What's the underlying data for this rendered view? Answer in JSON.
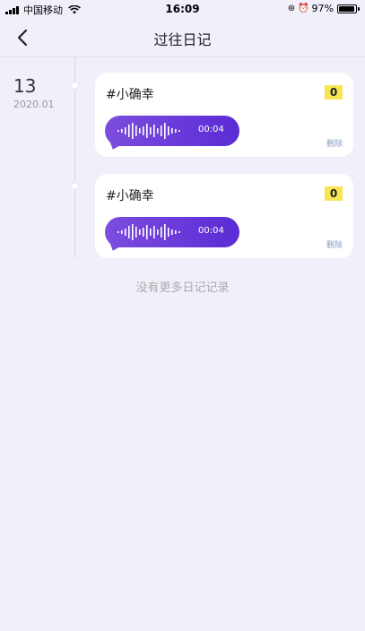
{
  "status_bar": {
    "carrier": "中国移动",
    "time": "16:09",
    "battery_text": "97%",
    "battery_level": 0.97
  },
  "nav": {
    "title": "过往日记"
  },
  "timeline": {
    "day": "13",
    "year_month": "2020.01"
  },
  "entries": [
    {
      "tag": "#小确幸",
      "count": "0",
      "duration": "00:04",
      "delete_label": "删除"
    },
    {
      "tag": "#小确幸",
      "count": "0",
      "duration": "00:04",
      "delete_label": "删除"
    }
  ],
  "footer": {
    "no_more_text": "没有更多日记记录"
  },
  "colors": {
    "accent_purple": "#6a3ad9",
    "count_badge": "#f7e553",
    "background": "#f0f0fa"
  }
}
